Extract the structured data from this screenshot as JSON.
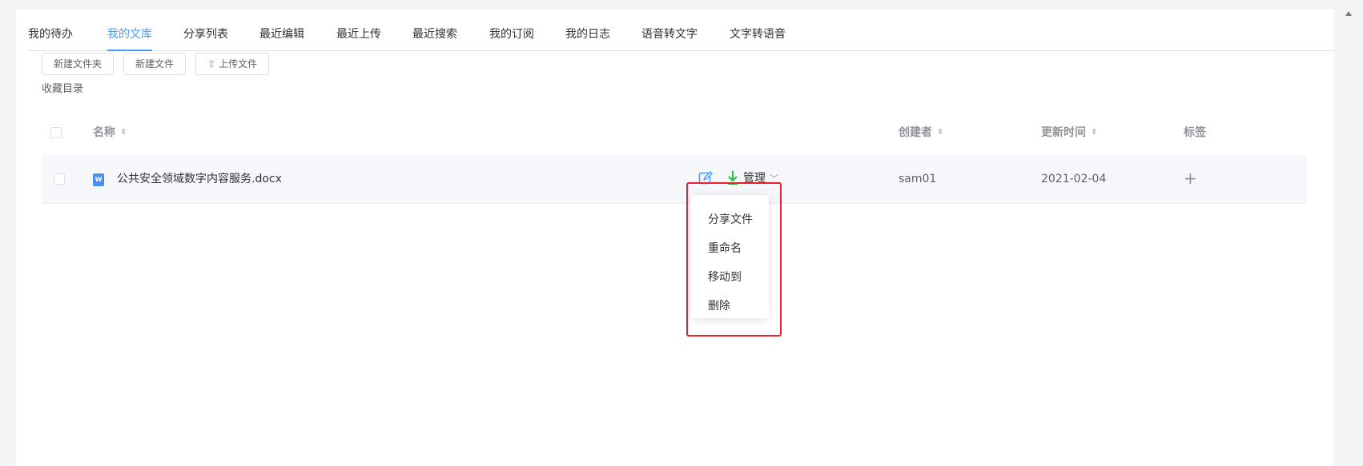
{
  "tabs": [
    {
      "label": "我的待办",
      "active": false
    },
    {
      "label": "我的文库",
      "active": true
    },
    {
      "label": "分享列表",
      "active": false
    },
    {
      "label": "最近编辑",
      "active": false
    },
    {
      "label": "最近上传",
      "active": false
    },
    {
      "label": "最近搜索",
      "active": false
    },
    {
      "label": "我的订阅",
      "active": false
    },
    {
      "label": "我的日志",
      "active": false
    },
    {
      "label": "语音转文字",
      "active": false
    },
    {
      "label": "文字转语音",
      "active": false
    }
  ],
  "toolbar": {
    "new_folder": "新建文件夹",
    "new_file": "新建文件",
    "upload_file": "上传文件",
    "upload_icon": "upload-icon"
  },
  "favorites_label": "收藏目录",
  "table": {
    "columns": {
      "name": "名称",
      "creator": "创建者",
      "updated": "更新时间",
      "tags": "标签"
    },
    "rows": [
      {
        "file_icon": "word-doc-icon",
        "file_icon_letter": "W",
        "name": "公共安全领域数字内容服务.docx",
        "manage_label": "管理",
        "creator": "sam01",
        "updated": "2021-02-04",
        "tag_add": "+"
      }
    ]
  },
  "dropdown": {
    "items": [
      "分享文件",
      "重命名",
      "移动到",
      "删除"
    ]
  },
  "colors": {
    "accent": "#409eff",
    "download": "#27c24c",
    "highlight": "#e8212e"
  }
}
